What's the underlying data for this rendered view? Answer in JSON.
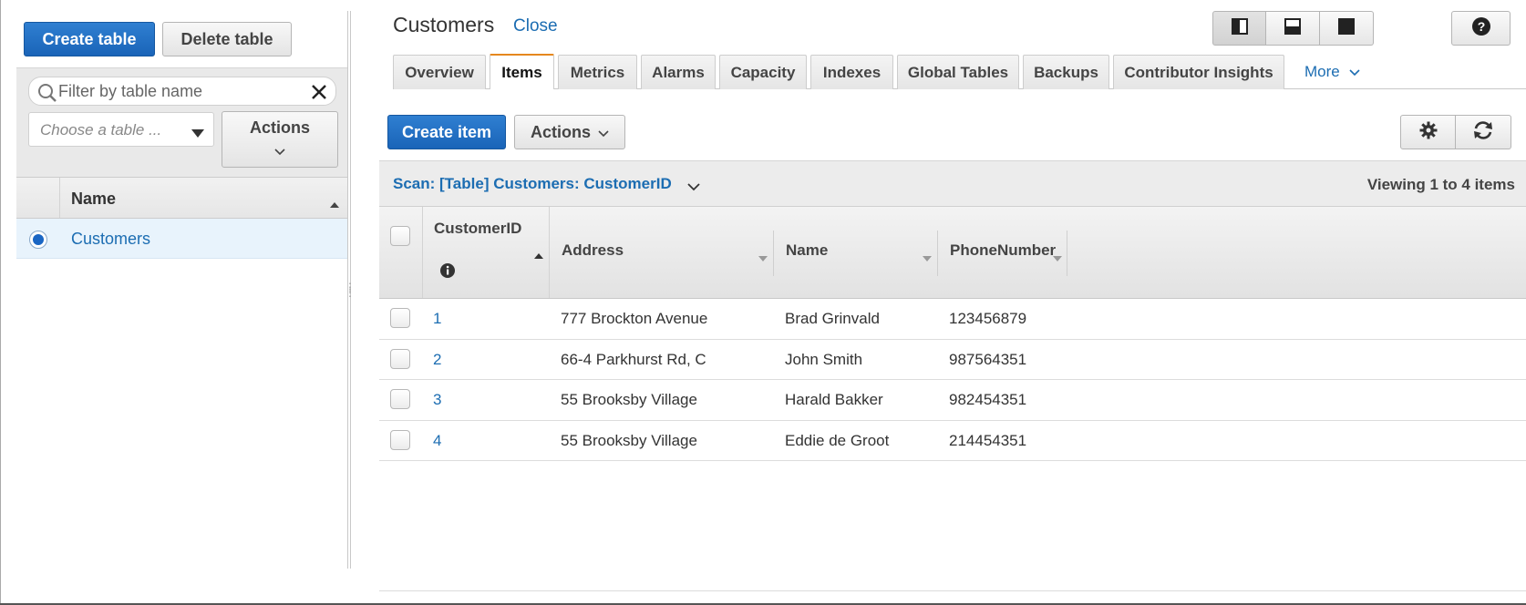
{
  "left_panel": {
    "create_table_label": "Create table",
    "delete_table_label": "Delete table",
    "filter_placeholder": "Filter by table name",
    "choose_table_placeholder": "Choose a table ...",
    "actions_label": "Actions",
    "table_header": "Name",
    "tables": [
      "Customers"
    ],
    "selected_table": "Customers"
  },
  "main": {
    "title": "Customers",
    "close_label": "Close",
    "tabs": [
      "Overview",
      "Items",
      "Metrics",
      "Alarms",
      "Capacity",
      "Indexes",
      "Global Tables",
      "Backups",
      "Contributor Insights"
    ],
    "active_tab": "Items",
    "more_label": "More",
    "create_item_label": "Create item",
    "actions_label": "Actions",
    "scan_label": "Scan: [Table] Customers: CustomerID",
    "viewing_text": "Viewing 1 to 4 items",
    "columns": [
      "CustomerID",
      "Address",
      "Name",
      "PhoneNumber"
    ],
    "rows": [
      {
        "id": "1",
        "address": "777 Brockton Avenue",
        "name": "Brad Grinvald",
        "phone": "123456879"
      },
      {
        "id": "2",
        "address": "66-4 Parkhurst Rd, C",
        "name": "John Smith",
        "phone": "987564351"
      },
      {
        "id": "3",
        "address": "55 Brooksby Village",
        "name": "Harald Bakker",
        "phone": "982454351"
      },
      {
        "id": "4",
        "address": "55 Brooksby Village",
        "name": "Eddie de Groot",
        "phone": "214454351"
      }
    ]
  },
  "icons": {
    "search": "search-icon",
    "clear": "close-icon",
    "dropdown": "caret-down-icon",
    "layout_split_vertical": "layout-split-vertical-icon",
    "layout_split_horizontal": "layout-split-horizontal-icon",
    "layout_full": "layout-full-icon",
    "help": "help-icon",
    "settings": "gear-icon",
    "refresh": "refresh-icon",
    "info": "info-icon"
  },
  "colors": {
    "primary": "#1a64b8",
    "link": "#1c6db2",
    "active_tab_accent": "#e5871e",
    "selected_row": "#e8f3fc"
  }
}
